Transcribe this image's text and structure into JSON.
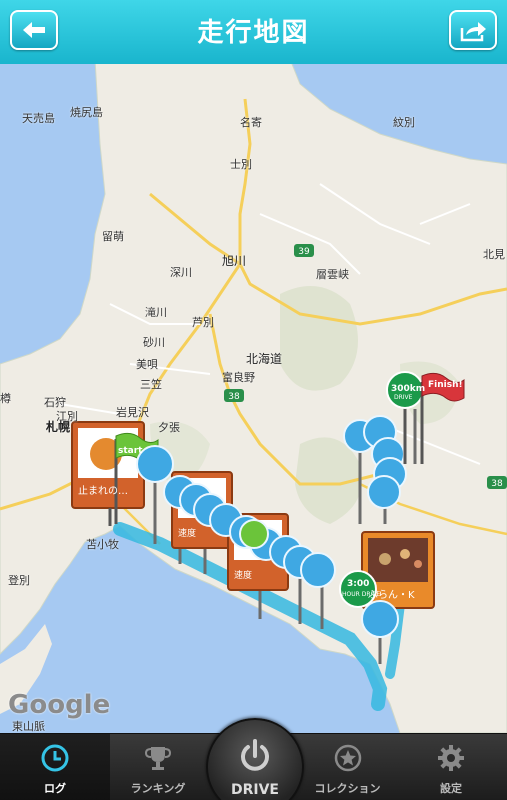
{
  "header": {
    "title": "走行地図",
    "back_icon": "back-arrow-icon",
    "share_icon": "share-icon",
    "accent": "#2bc3dc"
  },
  "map": {
    "places": [
      {
        "name": "天売島"
      },
      {
        "name": "焼尻島"
      },
      {
        "name": "名寄"
      },
      {
        "name": "紋別"
      },
      {
        "name": "士別"
      },
      {
        "name": "留萌"
      },
      {
        "name": "旭川"
      },
      {
        "name": "深川"
      },
      {
        "name": "層雲峡"
      },
      {
        "name": "北見"
      },
      {
        "name": "滝川"
      },
      {
        "name": "芦別"
      },
      {
        "name": "砂川"
      },
      {
        "name": "北海道"
      },
      {
        "name": "美唄"
      },
      {
        "name": "富良野"
      },
      {
        "name": "三笠"
      },
      {
        "name": "樽"
      },
      {
        "name": "石狩"
      },
      {
        "name": "岩見沢"
      },
      {
        "name": "夕張"
      },
      {
        "name": "江別"
      },
      {
        "name": "札幌"
      },
      {
        "name": "苫小牧"
      },
      {
        "name": "登別"
      },
      {
        "name": "東山脈"
      }
    ],
    "route_shields": [
      "39",
      "38",
      "38",
      "39"
    ],
    "provider_logo": "Google",
    "markers": {
      "start_flag": "start",
      "finish_flag": "Finish!",
      "photo_left_caption": "止まれの…",
      "photo_right_caption": "ぷらん・K",
      "speed_sign_1": "速度",
      "speed_sign_2": "速度",
      "milestone_300": "300km",
      "milestone_300_sub": "DRIVE",
      "milestone_300h": "3:00",
      "milestone_300h_sub": "HOUR DRIVE"
    }
  },
  "tabbar": {
    "tabs": [
      {
        "label": "ログ",
        "icon": "clock-icon"
      },
      {
        "label": "ランキング",
        "icon": "trophy-icon"
      },
      {
        "label": "DRIVE",
        "icon": "power-icon"
      },
      {
        "label": "コレクション",
        "icon": "star-badge-icon"
      },
      {
        "label": "設定",
        "icon": "gear-icon"
      }
    ],
    "active_tab": "ログ"
  }
}
